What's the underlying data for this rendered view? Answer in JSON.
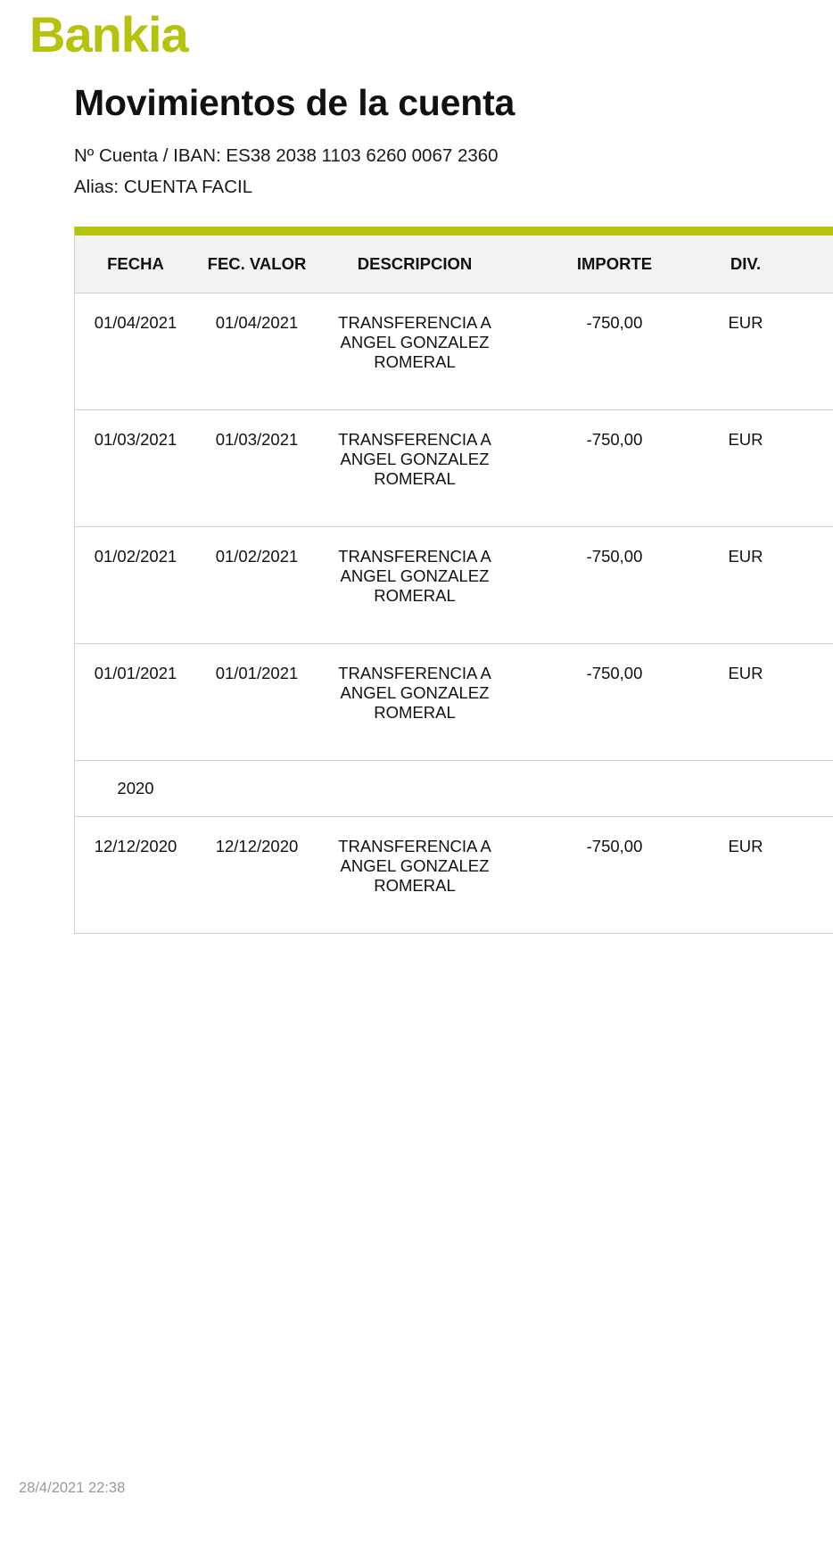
{
  "brand": {
    "logo_text": "Bankia",
    "color": "#b5c30f"
  },
  "header": {
    "title": "Movimientos de la cuenta",
    "iban": "Nº Cuenta / IBAN: ES38 2038 1103 6260 0067 2360",
    "alias": "Alias: CUENTA FACIL"
  },
  "table": {
    "columns": [
      "FECHA",
      "FEC. VALOR",
      "DESCRIPCION",
      "IMPORTE",
      "DIV.",
      ""
    ],
    "rows": [
      {
        "type": "movement",
        "fecha": "01/04/2021",
        "fec_valor": "01/04/2021",
        "descripcion": "TRANSFERENCIA A ANGEL GONZALEZ ROMERAL",
        "importe": "-750,00",
        "div": "EUR"
      },
      {
        "type": "movement",
        "fecha": "01/03/2021",
        "fec_valor": "01/03/2021",
        "descripcion": "TRANSFERENCIA A ANGEL GONZALEZ ROMERAL",
        "importe": "-750,00",
        "div": "EUR"
      },
      {
        "type": "movement",
        "fecha": "01/02/2021",
        "fec_valor": "01/02/2021",
        "descripcion": "TRANSFERENCIA A ANGEL GONZALEZ ROMERAL",
        "importe": "-750,00",
        "div": "EUR"
      },
      {
        "type": "movement",
        "fecha": "01/01/2021",
        "fec_valor": "01/01/2021",
        "descripcion": "TRANSFERENCIA A ANGEL GONZALEZ ROMERAL",
        "importe": "-750,00",
        "div": "EUR"
      },
      {
        "type": "year",
        "label": "2020"
      },
      {
        "type": "movement",
        "fecha": "12/12/2020",
        "fec_valor": "12/12/2020",
        "descripcion": "TRANSFERENCIA A ANGEL GONZALEZ ROMERAL",
        "importe": "-750,00",
        "div": "EUR"
      }
    ]
  },
  "footer": {
    "timestamp": "28/4/2021 22:38"
  }
}
